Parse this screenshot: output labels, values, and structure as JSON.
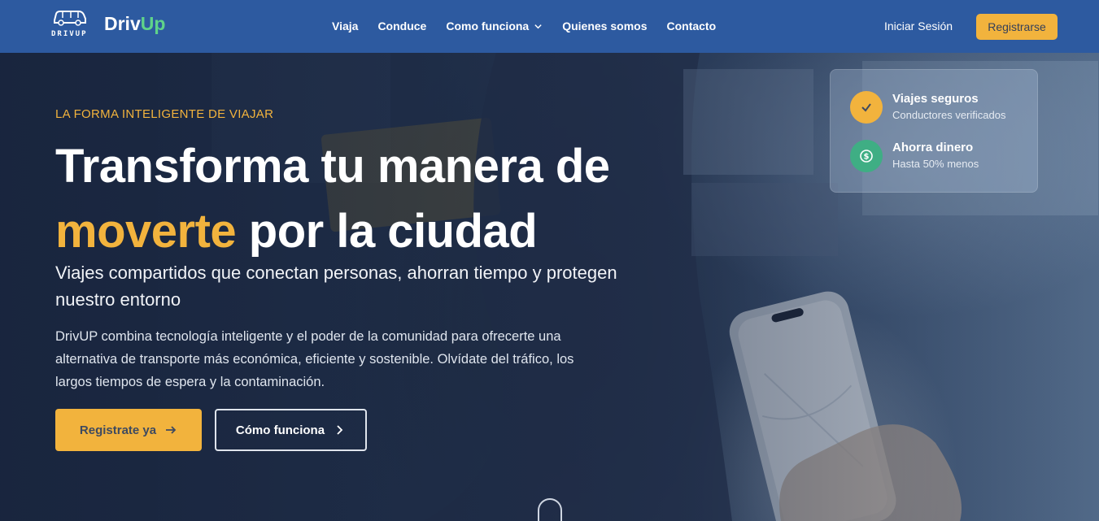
{
  "brand": {
    "logo_text": "DRIVUP",
    "name_part1": "Driv",
    "name_part2": "Up"
  },
  "nav": {
    "links": [
      {
        "label": "Viaja"
      },
      {
        "label": "Conduce"
      },
      {
        "label": "Como funciona"
      },
      {
        "label": "Quienes somos"
      },
      {
        "label": "Contacto"
      }
    ],
    "login_label": "Iniciar Sesión",
    "register_label": "Registrarse"
  },
  "hero": {
    "eyebrow": "LA FORMA INTELIGENTE DE VIAJAR",
    "headline_part1": "Transforma tu manera de",
    "headline_highlight": "moverte",
    "headline_part2": "por la ciudad",
    "subhead": "Viajes compartidos que conectan personas, ahorran tiempo y protegen nuestro entorno",
    "description": "DrivUP combina tecnología inteligente y el poder de la comunidad para ofrecerte una alternativa de transporte más económica, eficiente y sostenible. Olvídate del tráfico, los largos tiempos de espera y la contaminación.",
    "primary_cta": "Registrate ya",
    "secondary_cta": "Cómo funciona"
  },
  "features": [
    {
      "title": "Viajes seguros",
      "subtitle": "Conductores verificados",
      "icon": "check-icon",
      "color": "#f2b33d"
    },
    {
      "title": "Ahorra dinero",
      "subtitle": "Hasta 50% menos",
      "icon": "dollar-icon",
      "color": "#3fae84"
    }
  ],
  "colors": {
    "nav_bg": "#2d5aa0",
    "accent": "#f2b33d",
    "brand_green": "#5fd38a"
  }
}
